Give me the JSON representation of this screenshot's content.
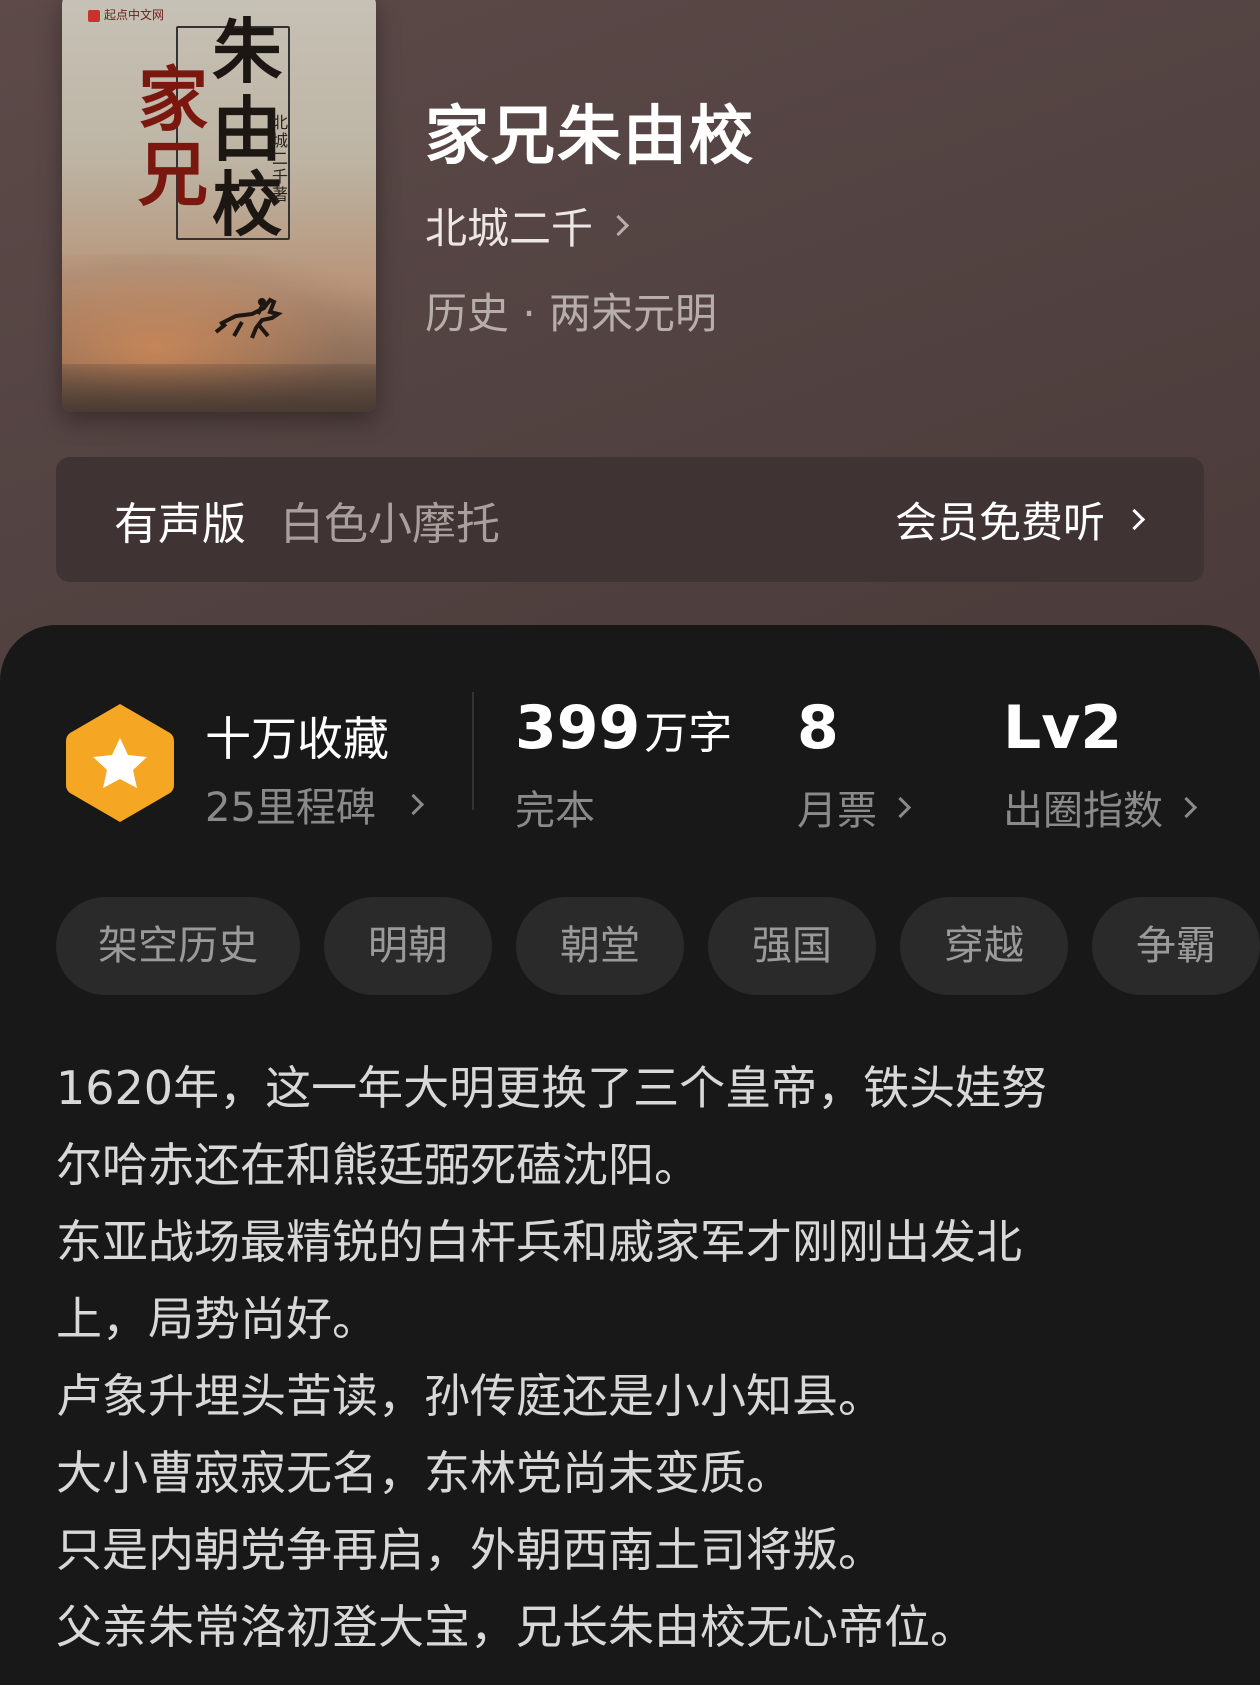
{
  "book": {
    "cover_badge": "起点中文网",
    "cover_title_chars": [
      "朱",
      "家",
      "由",
      "兄",
      "校"
    ],
    "cover_author": "北城二千著",
    "title": "家兄朱由校",
    "author": "北城二千",
    "genre": "历史 · 两宋元明"
  },
  "audio": {
    "label": "有声版",
    "narrator": "白色小摩托",
    "cta": "会员免费听"
  },
  "stats": {
    "collection_title": "十万收藏",
    "milestone": "25里程碑",
    "word_count": "399",
    "word_unit": "万字",
    "status": "完本",
    "monthly_tickets": "8",
    "monthly_label": "月票",
    "level": "Lv2",
    "level_label": "出圈指数"
  },
  "tags": [
    "架空历史",
    "明朝",
    "朝堂",
    "强国",
    "穿越",
    "争霸"
  ],
  "description": [
    "1620年，这一年大明更换了三个皇帝，铁头娃努",
    "尔哈赤还在和熊廷弼死磕沈阳。",
    "东亚战场最精锐的白杆兵和戚家军才刚刚出发北",
    "上，局势尚好。",
    "卢象升埋头苦读，孙传庭还是小小知县。",
    "大小曹寂寂无名，东林党尚未变质。",
    "只是内朝党争再启，外朝西南土司将叛。",
    "父亲朱常洛初登大宝，兄长朱由校无心帝位。"
  ],
  "colors": {
    "hero_bg": "#534342",
    "audio_bar_bg": "#3f3333",
    "panel_bg": "#181818",
    "badge_orange": "#f5a623",
    "tag_bg": "#2a2a2a"
  },
  "icons": [
    "chevron-right-icon",
    "star-hexagon-icon"
  ]
}
